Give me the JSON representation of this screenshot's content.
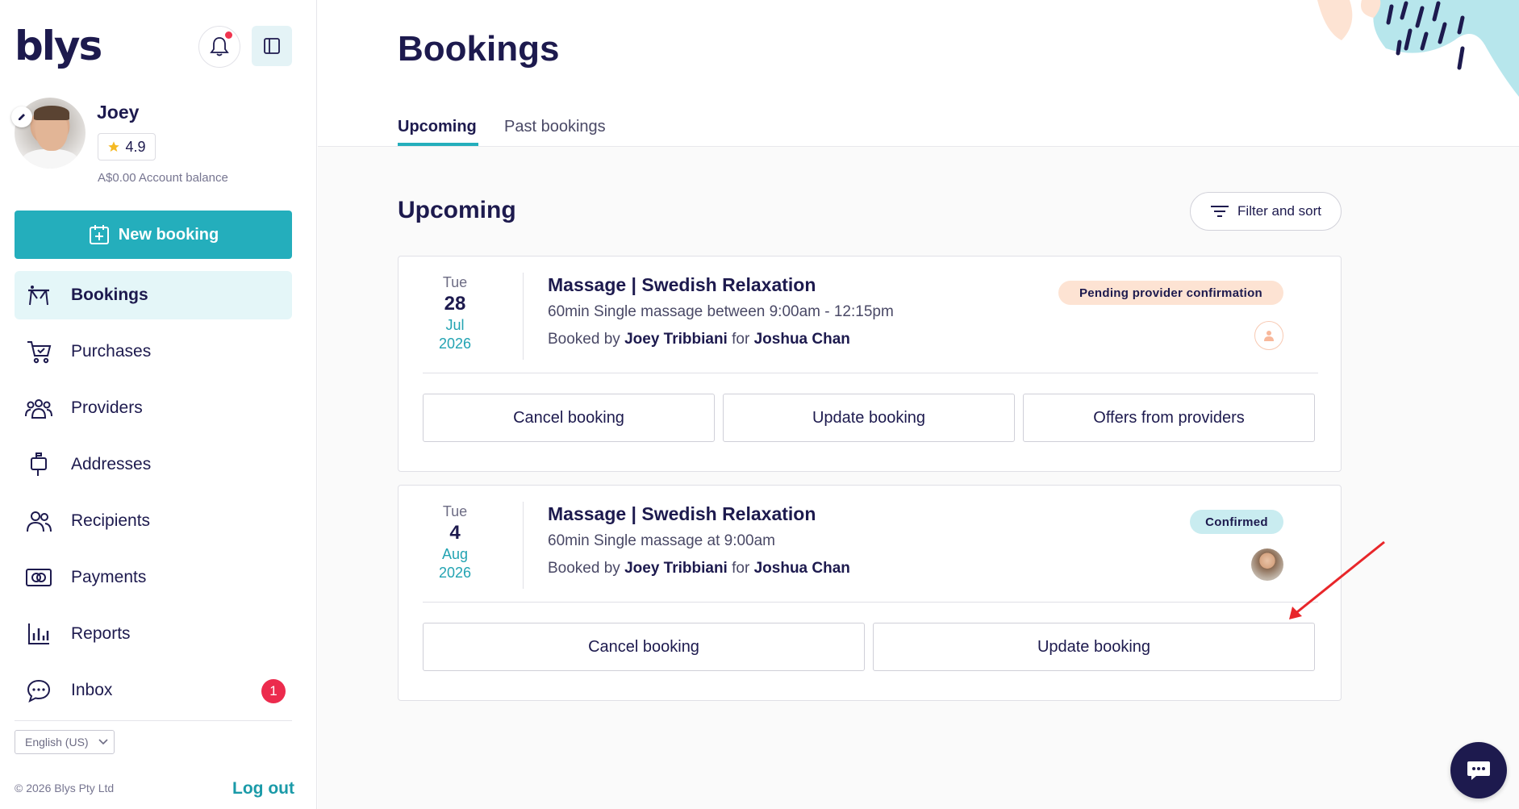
{
  "brand": {
    "logo_text": "blys",
    "accent": "#24aebc",
    "navy": "#1d1a4e"
  },
  "user": {
    "name": "Joey",
    "rating": "4.9",
    "balance": "A$0.00 Account balance"
  },
  "sidebar": {
    "new_booking_label": "New booking",
    "items": [
      {
        "label": "Bookings",
        "icon": "massage-table-icon",
        "active": true
      },
      {
        "label": "Purchases",
        "icon": "cart-icon"
      },
      {
        "label": "Providers",
        "icon": "people-group-icon"
      },
      {
        "label": "Addresses",
        "icon": "mailbox-icon"
      },
      {
        "label": "Recipients",
        "icon": "users-icon"
      },
      {
        "label": "Payments",
        "icon": "money-icon"
      },
      {
        "label": "Reports",
        "icon": "bar-chart-icon"
      },
      {
        "label": "Inbox",
        "icon": "chat-bubble-icon",
        "badge": "1"
      }
    ],
    "language": "English (US)",
    "copyright": "© 2026 Blys Pty Ltd",
    "logout": "Log out"
  },
  "main": {
    "title": "Bookings",
    "tabs": [
      {
        "label": "Upcoming",
        "active": true
      },
      {
        "label": "Past bookings"
      }
    ],
    "section_title": "Upcoming",
    "filter_label": "Filter and sort",
    "bookings": [
      {
        "dow": "Tue",
        "day": "28",
        "month": "Jul",
        "year": "2026",
        "title": "Massage | Swedish Relaxation",
        "desc": "60min Single massage between 9:00am - 12:15pm",
        "by_prefix": "Booked by",
        "booked_by": "Joey Tribbiani",
        "for_word": "for",
        "recipient": "Joshua Chan",
        "status": "Pending provider confirmation",
        "status_color": "#fde3d3",
        "actions": [
          "Cancel booking",
          "Update booking",
          "Offers from providers"
        ]
      },
      {
        "dow": "Tue",
        "day": "4",
        "month": "Aug",
        "year": "2026",
        "title": "Massage | Swedish Relaxation",
        "desc": "60min Single massage at 9:00am",
        "by_prefix": "Booked by",
        "booked_by": "Joey Tribbiani",
        "for_word": "for",
        "recipient": "Joshua Chan",
        "status": "Confirmed",
        "status_color": "#c9ecf0",
        "actions": [
          "Cancel booking",
          "Update booking"
        ]
      }
    ]
  }
}
